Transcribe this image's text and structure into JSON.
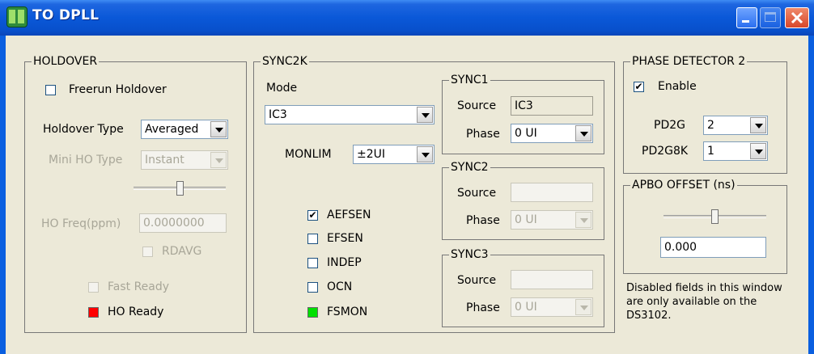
{
  "window": {
    "title": "TO DPLL"
  },
  "holdover": {
    "label": "HOLDOVER",
    "freerun_holdover": {
      "label": "Freerun Holdover",
      "checked": false
    },
    "holdover_type": {
      "label": "Holdover Type",
      "value": "Averaged"
    },
    "mini_ho_type": {
      "label": "Mini HO Type",
      "value": "Instant"
    },
    "slider_level": 0.5,
    "ho_freq": {
      "label": "HO Freq(ppm)",
      "value": "0.0000000"
    },
    "rdavg": {
      "label": "RDAVG",
      "checked": false
    },
    "fast_ready": {
      "label": "Fast Ready",
      "checked": false
    },
    "ho_ready": {
      "label": "HO Ready",
      "indicator_color": "#ff0000"
    }
  },
  "sync2k": {
    "label": "SYNC2K",
    "mode": {
      "label": "Mode",
      "value": "IC3"
    },
    "monlim": {
      "label": "MONLIM",
      "value": "±2UI"
    },
    "aefsen": {
      "label": "AEFSEN",
      "checked": true
    },
    "efsen": {
      "label": "EFSEN",
      "checked": false
    },
    "indep": {
      "label": "INDEP",
      "checked": false
    },
    "ocn": {
      "label": "OCN",
      "checked": false
    },
    "fsmon": {
      "label": "FSMON",
      "indicator_color": "#00e000"
    },
    "sync1": {
      "label": "SYNC1",
      "source_label": "Source",
      "source_value": "IC3",
      "phase_label": "Phase",
      "phase_value": "0 UI"
    },
    "sync2": {
      "label": "SYNC2",
      "source_label": "Source",
      "source_value": "",
      "phase_label": "Phase",
      "phase_value": "0 UI"
    },
    "sync3": {
      "label": "SYNC3",
      "source_label": "Source",
      "source_value": "",
      "phase_label": "Phase",
      "phase_value": "0 UI"
    }
  },
  "phase_detector_2": {
    "label": "PHASE DETECTOR 2",
    "enable": {
      "label": "Enable",
      "checked": true
    },
    "pd2g": {
      "label": "PD2G",
      "value": "2"
    },
    "pd2g8k": {
      "label": "PD2G8K",
      "value": "1"
    }
  },
  "apbo_offset": {
    "label": "APBO OFFSET (ns)",
    "slider_level": 0.5,
    "value": "0.000"
  },
  "note": {
    "line1": "Disabled fields in this window",
    "line2": "are only available on the",
    "line3": "DS3102."
  },
  "check_glyph": "✔"
}
